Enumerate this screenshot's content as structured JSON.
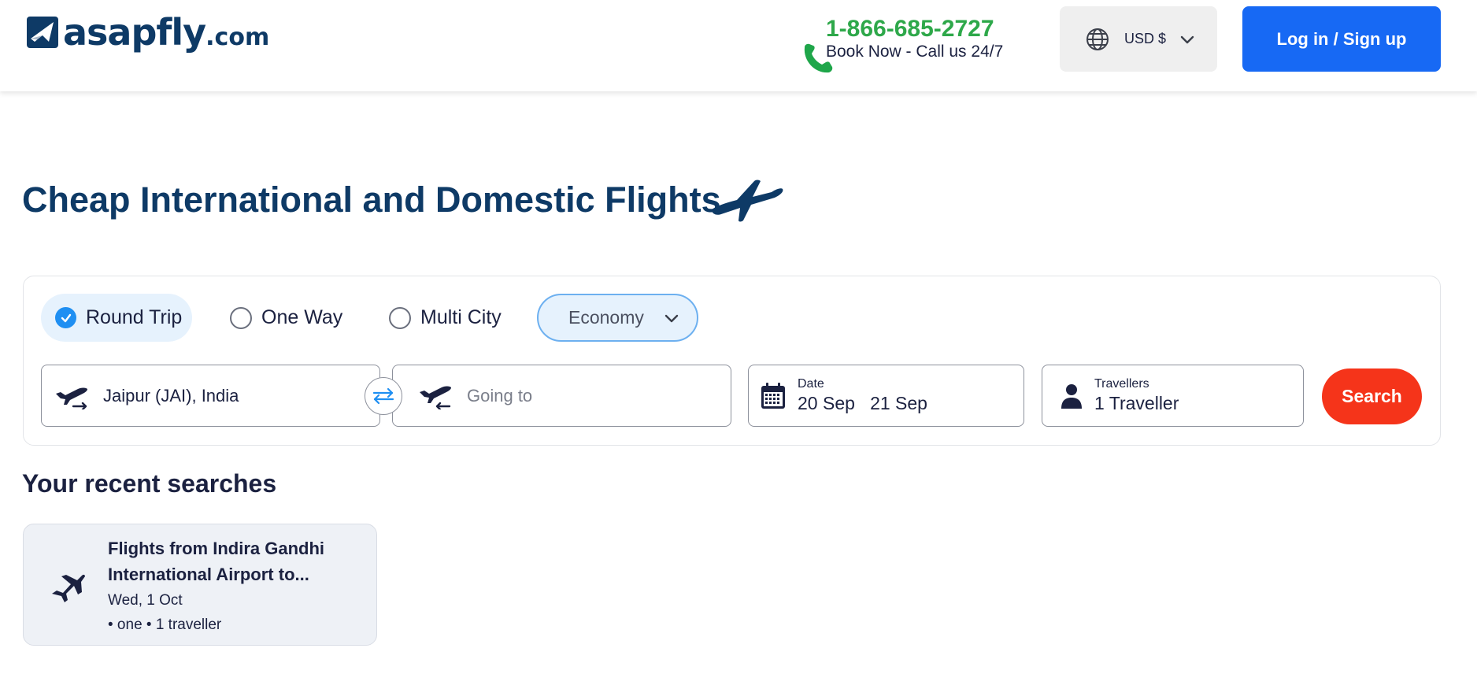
{
  "header": {
    "logo_main": "asapfly",
    "logo_suffix": ".com",
    "phone_number": "1-866-685-2727",
    "phone_subtitle": "Book Now - Call us 24/7",
    "currency_label": "USD $",
    "login_label": "Log in / Sign up"
  },
  "hero": {
    "title": "Cheap International and Domestic Flights"
  },
  "search": {
    "trip_types": [
      {
        "label": "Round Trip",
        "selected": true
      },
      {
        "label": "One Way",
        "selected": false
      },
      {
        "label": "Multi City",
        "selected": false
      }
    ],
    "cabin_class": "Economy",
    "from_value": "Jaipur (JAI), India",
    "to_placeholder": "Going to",
    "date_caption": "Date",
    "depart_date": "20 Sep",
    "return_date": "21 Sep",
    "travellers_caption": "Travellers",
    "travellers_value": "1 Traveller",
    "search_label": "Search"
  },
  "recent": {
    "title": "Your recent searches",
    "items": [
      {
        "title": "Flights from Indira Gandhi International Airport to...",
        "date": "Wed, 1 Oct",
        "meta": "• one • 1 traveller"
      }
    ]
  },
  "colors": {
    "brand_navy": "#0e3a66",
    "phone_green": "#2ea84a",
    "login_blue": "#1769f4",
    "search_red": "#f5341a",
    "radio_blue": "#1f8ff2"
  }
}
